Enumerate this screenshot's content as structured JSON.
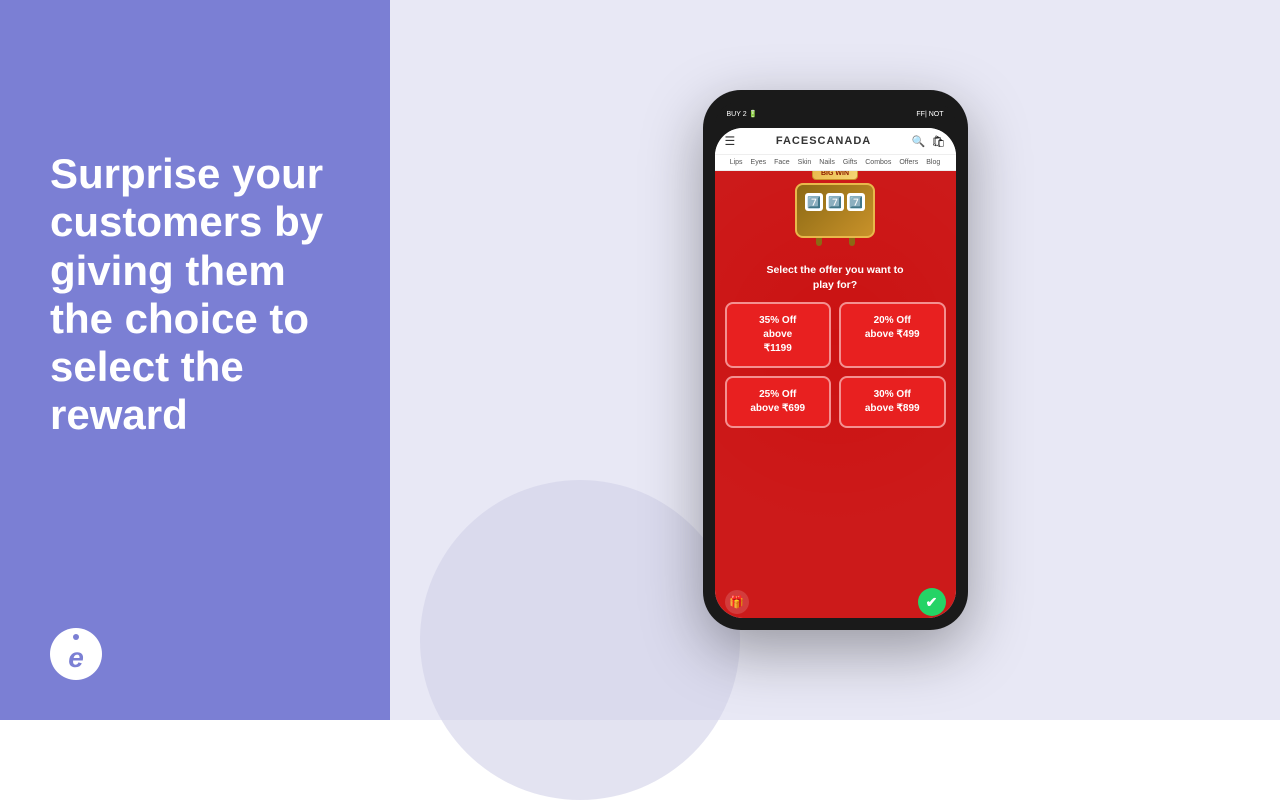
{
  "left": {
    "headline": "Surprise your customers by giving them the choice to select the reward",
    "logo_letter": "e"
  },
  "phone": {
    "status_left": "BUY 2 🔋",
    "status_right": "FF| NOT",
    "brand": "FACESCANADA",
    "nav_items": [
      "Lips",
      "Eyes",
      "Face",
      "Skin",
      "Nails",
      "Gifts",
      "Combos",
      "Offers",
      "Blog"
    ],
    "slot_banner": "BIG WIN",
    "slot_emojis": [
      "7️⃣",
      "7️⃣",
      "7️⃣"
    ],
    "prompt_line1": "Select the offer you want to",
    "prompt_line2": "play for?",
    "offers": [
      {
        "line1": "35% Off",
        "line2": "above",
        "line3": "₹1199"
      },
      {
        "line1": "20% Off",
        "line2": "above ₹499",
        "line3": ""
      },
      {
        "line1": "25% Off",
        "line2": "above ₹699",
        "line3": ""
      },
      {
        "line1": "30% Off",
        "line2": "above ₹899",
        "line3": ""
      }
    ]
  }
}
